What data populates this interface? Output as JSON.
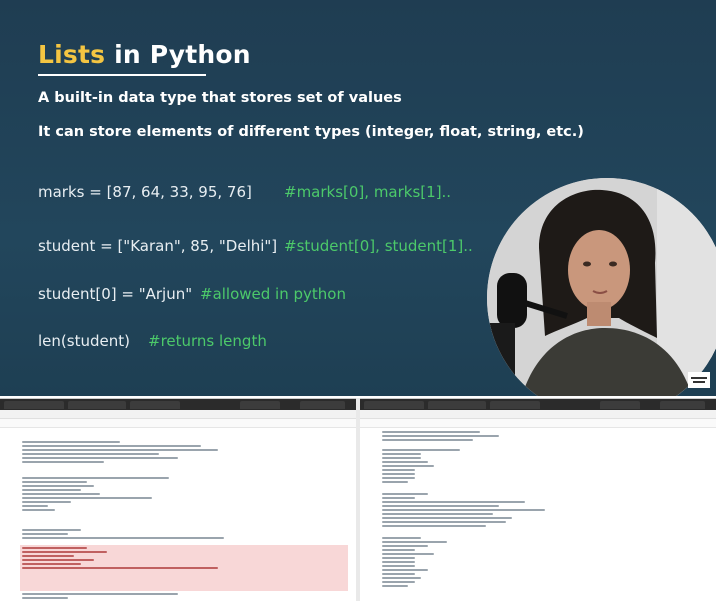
{
  "slide": {
    "title_accent": "Lists",
    "title_rest": " in Python",
    "subtitle1": "A built-in data type that stores set of values",
    "subtitle2": "It can store elements of different types (integer, float, string, etc.)",
    "examples": [
      {
        "code": "marks = [87, 64, 33, 95, 76]",
        "comment": "#marks[0], marks[1].."
      },
      {
        "code": "student = [\"Karan\", 85, \"Delhi\"]",
        "comment": "#student[0], student[1].."
      },
      {
        "code": "student[0] = \"Arjun\"",
        "comment": "#allowed in python"
      },
      {
        "code": "len(student)",
        "comment": "#returns length"
      }
    ]
  },
  "colors": {
    "accent": "#f4c542",
    "comment": "#4cc96a",
    "slide_bg": "#22465c"
  }
}
